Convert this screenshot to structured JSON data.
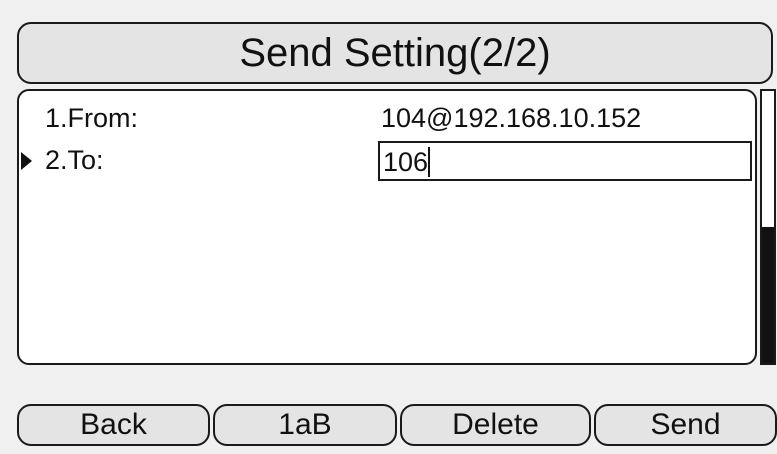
{
  "header": {
    "title": "Send Setting(2/2)"
  },
  "fields": [
    {
      "label": "1.From:",
      "value": "104@192.168.10.152"
    },
    {
      "label": "2.To:",
      "value": "106"
    }
  ],
  "scrollbar": {
    "position_fraction": 0.5
  },
  "softkeys": {
    "back": "Back",
    "input_mode": "1aB",
    "delete": "Delete",
    "send": "Send"
  }
}
